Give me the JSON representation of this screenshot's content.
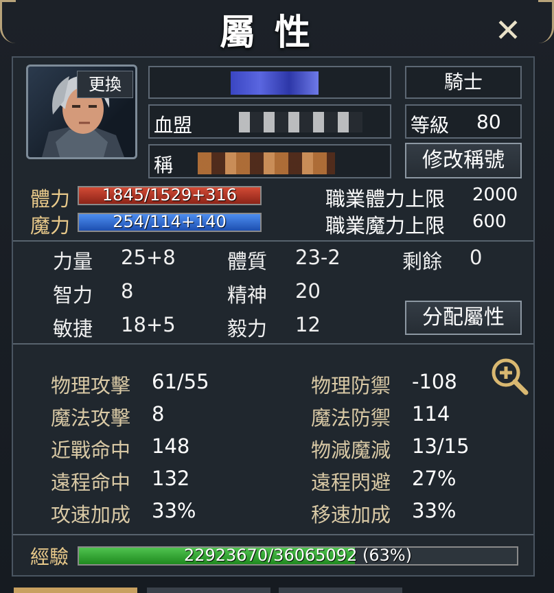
{
  "window": {
    "title": "屬性",
    "close_icon": "close-icon"
  },
  "profile": {
    "change_label": "更換",
    "class_name": "騎士",
    "clan_label": "血盟",
    "title_label": "稱",
    "level_label": "等級",
    "level_value": "80",
    "edit_title_label": "修改稱號"
  },
  "vitals": {
    "hp_label": "體力",
    "hp_text": "1845/1529+316",
    "hp_fraction": 1.0,
    "mp_label": "魔力",
    "mp_text": "254/114+140",
    "mp_fraction": 1.0,
    "class_hp_cap_label": "職業體力上限",
    "class_hp_cap_value": "2000",
    "class_mp_cap_label": "職業魔力上限",
    "class_mp_cap_value": "600"
  },
  "attributes": {
    "str_label": "力量",
    "str_value": "25+8",
    "con_label": "體質",
    "con_value": "23-2",
    "remain_label": "剩餘",
    "remain_value": "0",
    "int_label": "智力",
    "int_value": "8",
    "wis_label": "精神",
    "wis_value": "20",
    "dex_label": "敏捷",
    "dex_value": "18+5",
    "will_label": "毅力",
    "will_value": "12",
    "allocate_label": "分配屬性"
  },
  "combat": {
    "patk_label": "物理攻擊",
    "patk_value": "61/55",
    "pdef_label": "物理防禦",
    "pdef_value": "-108",
    "matk_label": "魔法攻擊",
    "matk_value": "8",
    "mdef_label": "魔法防禦",
    "mdef_value": "114",
    "melee_hit_label": "近戰命中",
    "melee_hit_value": "148",
    "reduce_label": "物減魔減",
    "reduce_value": "13/15",
    "ranged_hit_label": "遠程命中",
    "ranged_hit_value": "132",
    "ranged_evade_label": "遠程閃避",
    "ranged_evade_value": "27%",
    "atk_speed_label": "攻速加成",
    "atk_speed_value": "33%",
    "move_speed_label": "移速加成",
    "move_speed_value": "33%",
    "zoom_icon": "zoom-in-icon"
  },
  "experience": {
    "label": "經驗",
    "text": "22923670/36065092 (63%)",
    "fraction": 0.63
  },
  "colors": {
    "hp_bar": "#b83a2a",
    "mp_bar": "#2e6fd1",
    "exp_bar": "#2fa12f",
    "accent_gold": "#d9c9a5"
  }
}
